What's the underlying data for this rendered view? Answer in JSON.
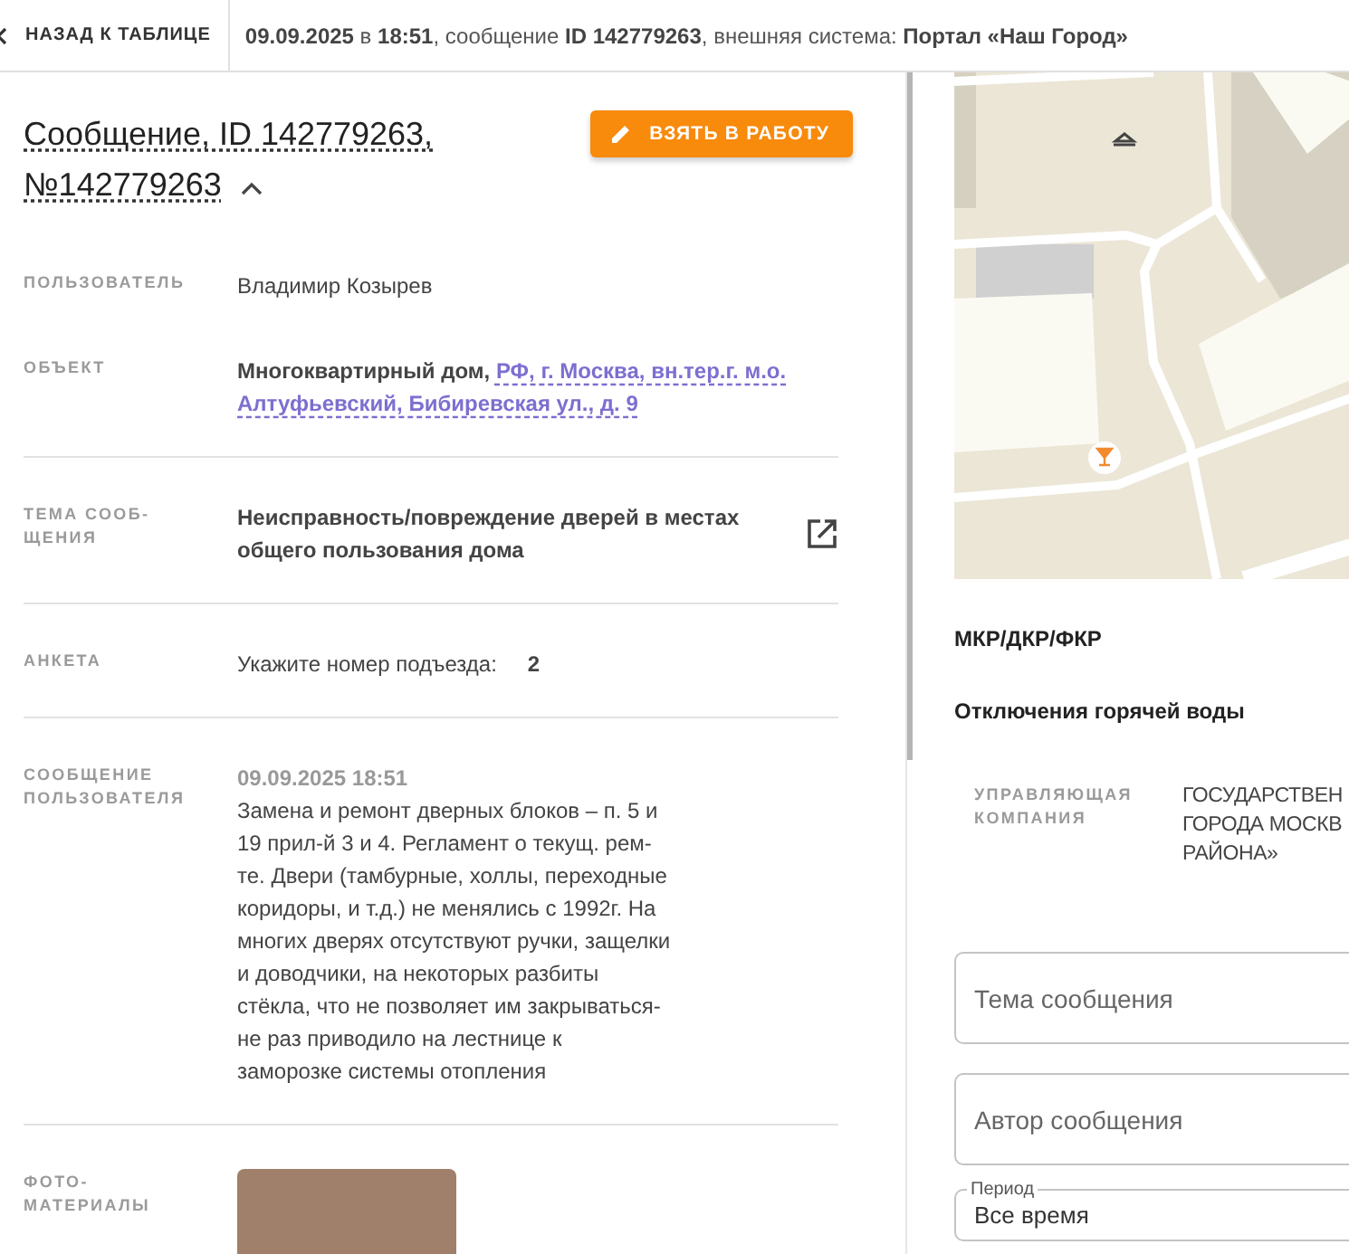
{
  "top_bar": {
    "back_label": "НАЗАД К ТАБЛИЦЕ",
    "summary": "**09.09.2025** в **18:51**, сообщение **ID 142779263**, внешняя система: **Портал «Наш Город»**"
  },
  "message": {
    "title": "Сообщение, ID 142779263,",
    "number": "№142779263",
    "expanded": true,
    "action_button": "ВЗЯТЬ В РАБОТУ",
    "fields": [
      {
        "kind": "text",
        "label": "ПОЛЬЗОВАТЕЛЬ",
        "value": "Владимир Козырев",
        "divider": false
      },
      {
        "kind": "object",
        "label": "ОБЪЕКТ",
        "value": "Многоквартирный дом,",
        "links": [
          "РФ, г. Москва, вн.тер.г. м.о.",
          "Алтуфьевский, Бибиревская ул., д. 9"
        ],
        "divider": false
      },
      {
        "kind": "topic",
        "label": "ТЕМА СООБ-ЩЕНИЯ",
        "value": "Неисправность/повреждение дверей в местах общего пользования дома",
        "divider": true
      },
      {
        "kind": "form",
        "label": "АНКЕТА",
        "question": "Укажите номер подъезда:",
        "answer": "2",
        "divider": true
      },
      {
        "kind": "post",
        "label": "СООБЩЕНИЕ ПОЛЬЗОВАТЕЛЯ",
        "date": "09.09.2025 18:51",
        "value": "Замена и ремонт дверных блоков – п. 5 и 19 прил-й 3 и 4. Регламент о текущ. рем-те. Двери (тамбурные, холлы, переходные коридоры, и т.д.) не менялись с 1992г. На многих дверях отсутствуют ручки, защелки и доводчики, на некоторых разбиты стёкла, что не позволяет им закрываться- не раз приводило на лестнице к заморозке системы отопления",
        "divider": true
      },
      {
        "kind": "photos",
        "label": "ФОТО-МАТЕРИАЛЫ",
        "divider": true
      }
    ]
  },
  "side": {
    "tags": [
      "МКР/ДКР/ФКР",
      "Отключения горячей воды"
    ],
    "company": {
      "label": "УПРАВЛЯЮЩАЯ КОМПАНИЯ",
      "lines": [
        "ГОСУДАРСТВЕН",
        "ГОРОДА МОСКВ",
        "РАЙОНА»"
      ]
    },
    "filters": [
      {
        "kind": "text",
        "placeholder": "Тема сообщения"
      },
      {
        "kind": "text",
        "placeholder": "Автор сообщения"
      },
      {
        "kind": "select",
        "label": "Период",
        "value": "Все время"
      }
    ]
  }
}
